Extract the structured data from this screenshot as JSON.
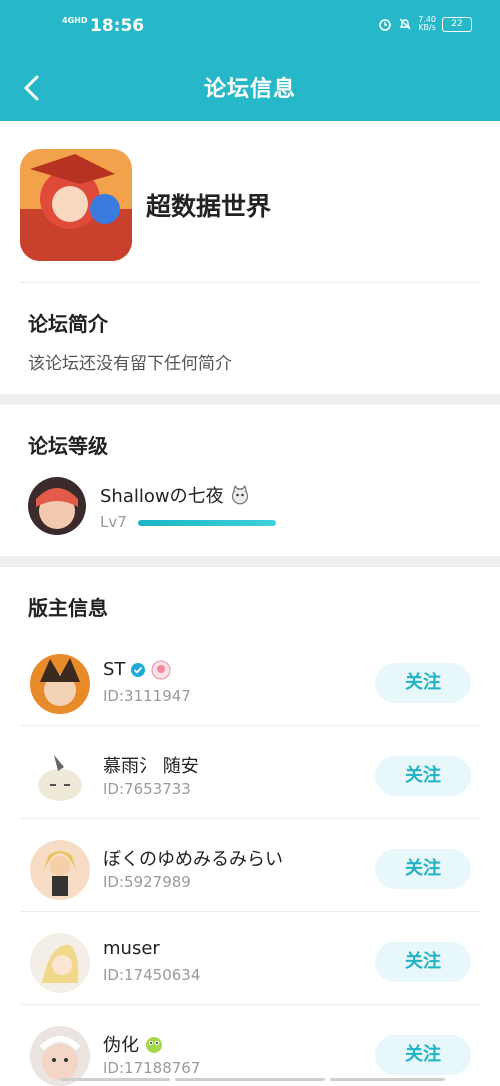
{
  "status_bar": {
    "network": "4GHD",
    "time": "18:56",
    "speed_value": "7.40",
    "speed_unit": "KB/s",
    "battery": "22"
  },
  "header": {
    "title": "论坛信息"
  },
  "forum": {
    "name": "超数据世界"
  },
  "intro": {
    "title": "论坛简介",
    "text": "该论坛还没有留下任何简介"
  },
  "level": {
    "title": "论坛等级",
    "user_name": "Shallowの七夜",
    "level_label": "Lv7",
    "progress": 1.0
  },
  "moderators": {
    "title": "版主信息",
    "follow_label": "关注",
    "items": [
      {
        "name": "ST",
        "id": "ID:3111947"
      },
      {
        "name": "慕雨氵 随安",
        "id": "ID:7653733"
      },
      {
        "name": "ぼくのゆめみるみらい",
        "id": "ID:5927989"
      },
      {
        "name": "muser",
        "id": "ID:17450634"
      },
      {
        "name": "伪化",
        "id": "ID:17188767"
      }
    ]
  },
  "colors": {
    "accent": "#26b8c8",
    "follow_bg": "#e8f7f9",
    "follow_text": "#20b3c3"
  }
}
